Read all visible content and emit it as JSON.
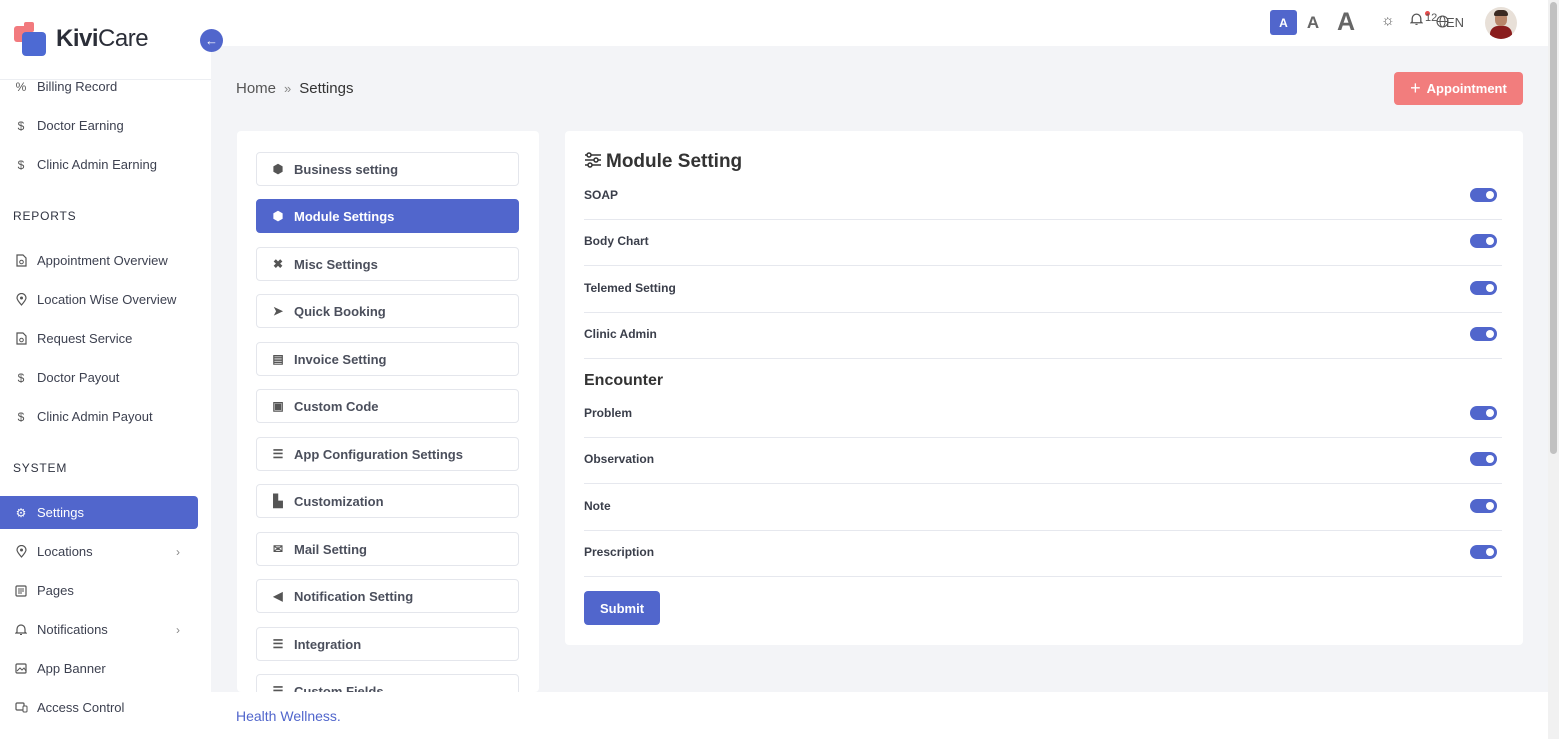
{
  "brand": {
    "name_bold": "Kivi",
    "name_rest": "Care"
  },
  "sidebar": {
    "items_top": [
      {
        "label": "Billing Record",
        "icon": "percent-icon"
      },
      {
        "label": "Doctor Earning",
        "icon": "dollar-icon"
      },
      {
        "label": "Clinic Admin Earning",
        "icon": "dollar-icon"
      }
    ],
    "reports_title": "REPORTS",
    "reports": [
      {
        "label": "Appointment Overview"
      },
      {
        "label": "Location Wise Overview"
      },
      {
        "label": "Request Service"
      },
      {
        "label": "Doctor Payout"
      },
      {
        "label": "Clinic Admin Payout"
      }
    ],
    "system_title": "SYSTEM",
    "system": [
      {
        "label": "Settings"
      },
      {
        "label": "Locations"
      },
      {
        "label": "Pages"
      },
      {
        "label": "Notifications"
      },
      {
        "label": "App Banner"
      },
      {
        "label": "Access Control"
      }
    ]
  },
  "topbar": {
    "font_small": "A",
    "font_medium": "A",
    "font_large": "A",
    "notification_count": "12",
    "language": "EN"
  },
  "breadcrumb": {
    "home": "Home",
    "current": "Settings"
  },
  "appointment_button": {
    "plus": "+",
    "label": "Appointment"
  },
  "settings_menu": [
    "Business setting",
    "Module Settings",
    "Misc Settings",
    "Quick Booking",
    "Invoice Setting",
    "Custom Code",
    "App Configuration Settings",
    "Customization",
    "Mail Setting",
    "Notification Setting",
    "Integration",
    "Custom Fields"
  ],
  "module": {
    "title": "Module Setting",
    "toggles": [
      {
        "label": "SOAP",
        "on": true
      },
      {
        "label": "Body Chart",
        "on": true
      },
      {
        "label": "Telemed Setting",
        "on": true
      },
      {
        "label": "Clinic Admin",
        "on": true
      }
    ],
    "encounter_title": "Encounter",
    "encounter_toggles": [
      {
        "label": "Problem",
        "on": true
      },
      {
        "label": "Observation",
        "on": true
      },
      {
        "label": "Note",
        "on": true
      },
      {
        "label": "Prescription",
        "on": true
      }
    ],
    "submit_label": "Submit"
  },
  "footer": {
    "text": "Health Wellness."
  },
  "colors": {
    "primary": "#5166cc",
    "accent": "#f27d7d"
  }
}
